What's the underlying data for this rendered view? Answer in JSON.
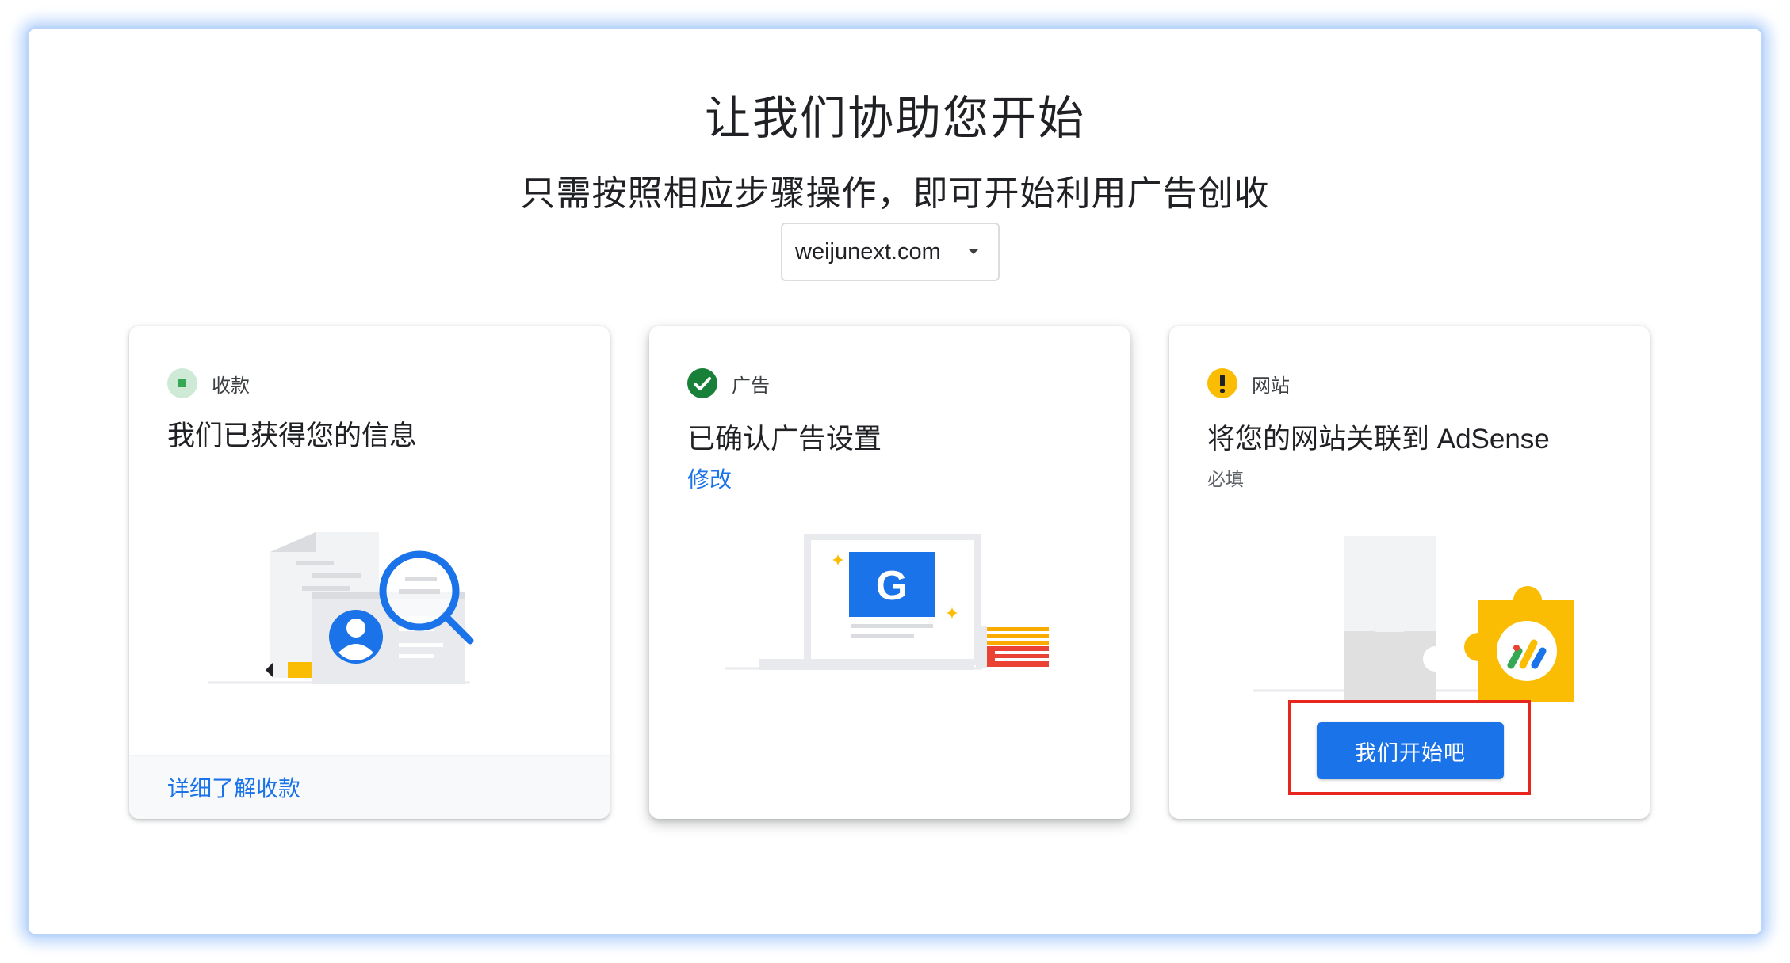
{
  "header": {
    "title": "让我们协助您开始",
    "subtitle": "只需按照相应步骤操作，即可开始利用广告创收"
  },
  "site_selector": {
    "value": "weijunext.com",
    "icon": "dropdown-arrow-icon"
  },
  "cards": [
    {
      "status_label": "收款",
      "status_icon": "pending-square-icon",
      "status_color": "#34a853",
      "heading": "我们已获得您的信息",
      "footer_link": "详细了解收款",
      "illustration": "document-id-magnifier-illustration"
    },
    {
      "status_label": "广告",
      "status_icon": "check-circle-icon",
      "status_color": "#188038",
      "heading": "已确认广告设置",
      "link": "修改",
      "illustration": "laptop-google-books-illustration"
    },
    {
      "status_label": "网站",
      "status_icon": "warning-circle-icon",
      "status_color": "#fbbc04",
      "heading": "将您的网站关联到 AdSense",
      "note": "必填",
      "button": "我们开始吧",
      "illustration": "puzzle-adsense-illustration"
    }
  ],
  "colors": {
    "accent_blue": "#1a73e8",
    "highlight_red": "#e8261d",
    "frame_glow": "#b7d3fb"
  }
}
